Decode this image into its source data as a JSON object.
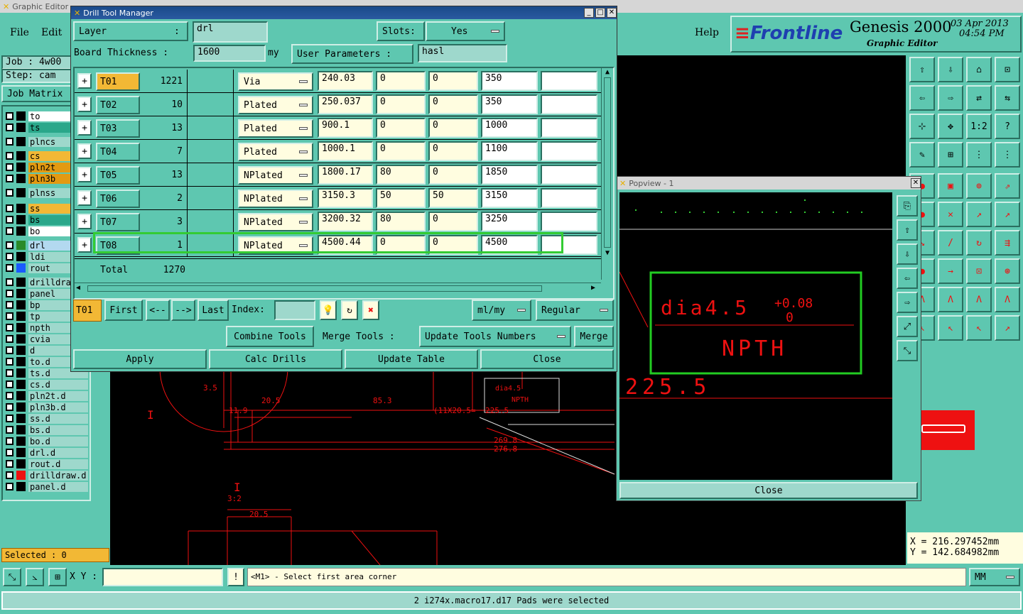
{
  "main_window": {
    "title": "Graphic Editor",
    "menu": [
      "File",
      "Edit"
    ],
    "help": "Help"
  },
  "brand": {
    "logo": "Frontline",
    "product": "Genesis 2000",
    "subtitle": "Graphic Editor",
    "date": "03 Apr 2013",
    "time": "04:54 PM"
  },
  "job": {
    "job_label": "Job : 4w00",
    "step_label": "Step: cam",
    "matrix_button": "Job Matrix"
  },
  "layers": [
    {
      "name": "to",
      "color": "#ffffff"
    },
    {
      "name": "ts",
      "color": "#2aa78a"
    },
    {
      "name": "plncs",
      "color": "#9ed8cc"
    },
    {
      "name": "cs",
      "color": "#f2b835"
    },
    {
      "name": "pln2t",
      "color": "#e39a12"
    },
    {
      "name": "pln3b",
      "color": "#e39a12"
    },
    {
      "name": "plnss",
      "color": "#9ed8cc"
    },
    {
      "name": "ss",
      "color": "#f2b835"
    },
    {
      "name": "bs",
      "color": "#2aa78a"
    },
    {
      "name": "bo",
      "color": "#ffffff"
    },
    {
      "name": "drl",
      "color": "#b3d9f0"
    },
    {
      "name": "ldi",
      "color": "#9ed8cc"
    },
    {
      "name": "rout",
      "color": "#9ed8cc"
    },
    {
      "name": "drilldraw",
      "color": "#9ed8cc"
    },
    {
      "name": "panel",
      "color": "#9ed8cc"
    },
    {
      "name": "bp",
      "color": "#9ed8cc"
    },
    {
      "name": "tp",
      "color": "#9ed8cc"
    },
    {
      "name": "npth",
      "color": "#9ed8cc"
    },
    {
      "name": "cvia",
      "color": "#9ed8cc"
    },
    {
      "name": "d",
      "color": "#9ed8cc"
    },
    {
      "name": "to.d",
      "color": "#9ed8cc"
    },
    {
      "name": "ts.d",
      "color": "#9ed8cc"
    },
    {
      "name": "cs.d",
      "color": "#9ed8cc"
    },
    {
      "name": "pln2t.d",
      "color": "#9ed8cc"
    },
    {
      "name": "pln3b.d",
      "color": "#9ed8cc"
    },
    {
      "name": "ss.d",
      "color": "#9ed8cc"
    },
    {
      "name": "bs.d",
      "color": "#9ed8cc"
    },
    {
      "name": "bo.d",
      "color": "#9ed8cc"
    },
    {
      "name": "drl.d",
      "color": "#9ed8cc"
    },
    {
      "name": "rout.d",
      "color": "#9ed8cc"
    },
    {
      "name": "drilldraw.d",
      "color": "#9ed8cc"
    },
    {
      "name": "panel.d",
      "color": "#9ed8cc"
    }
  ],
  "selected": "Selected : 0",
  "bottom": {
    "xy_label": "X Y :",
    "prompt": "<M1> - Select first area corner",
    "units": "MM",
    "status": "2 i274x.macro17.d17 Pads were selected"
  },
  "coords": {
    "x": "X = 216.297452mm",
    "y": "Y = 142.684982mm"
  },
  "dtm": {
    "title": "Drill Tool Manager",
    "layer_label": "Layer",
    "layer_colon": ":",
    "layer_value": "drl",
    "slots_label": "Slots:",
    "slots_value": "Yes",
    "thickness_label": "Board Thickness :",
    "thickness_value": "1600",
    "thickness_unit": "my",
    "userparams_label": "User Parameters :",
    "userparams_value": "hasl",
    "rows": [
      {
        "tool": "T01",
        "count": "1221",
        "type": "Via",
        "size": "240.03",
        "p1": "0",
        "p2": "0",
        "finish": "350",
        "extra": ""
      },
      {
        "tool": "T02",
        "count": "10",
        "type": "Plated",
        "size": "250.037",
        "p1": "0",
        "p2": "0",
        "finish": "350",
        "extra": ""
      },
      {
        "tool": "T03",
        "count": "13",
        "type": "Plated",
        "size": "900.1",
        "p1": "0",
        "p2": "0",
        "finish": "1000",
        "extra": ""
      },
      {
        "tool": "T04",
        "count": "7",
        "type": "Plated",
        "size": "1000.1",
        "p1": "0",
        "p2": "0",
        "finish": "1100",
        "extra": ""
      },
      {
        "tool": "T05",
        "count": "13",
        "type": "NPlated",
        "size": "1800.17",
        "p1": "80",
        "p2": "0",
        "finish": "1850",
        "extra": ""
      },
      {
        "tool": "T06",
        "count": "2",
        "type": "NPlated",
        "size": "3150.3",
        "p1": "50",
        "p2": "50",
        "finish": "3150",
        "extra": ""
      },
      {
        "tool": "T07",
        "count": "3",
        "type": "NPlated",
        "size": "3200.32",
        "p1": "80",
        "p2": "0",
        "finish": "3250",
        "extra": ""
      },
      {
        "tool": "T08",
        "count": "1",
        "type": "NPlated",
        "size": "4500.44",
        "p1": "0",
        "p2": "0",
        "finish": "4500",
        "extra": ""
      }
    ],
    "total_label": "Total",
    "total_value": "1270",
    "current_tool": "T01",
    "nav": {
      "first": "First",
      "prev": "<--",
      "next": "-->",
      "last": "Last",
      "index_label": "Index:"
    },
    "units_option": "ml/my",
    "mode_option": "Regular",
    "combine": "Combine Tools",
    "merge_label": "Merge Tools :",
    "update_numbers": "Update Tools Numbers",
    "merge": "Merge",
    "apply": "Apply",
    "calc": "Calc Drills",
    "update_table": "Update Table",
    "close": "Close"
  },
  "popview": {
    "title": "Popview - 1",
    "text1": "dia4.5",
    "tol_plus": "+0.08",
    "tol_minus": "0",
    "text2": "NPTH",
    "dim": "225.5",
    "close": "Close"
  },
  "drawing": {
    "labels": [
      "3.5",
      "20.5",
      "85.3",
      "11.9",
      "(11X20.5=",
      "225.5",
      "269.8",
      "276.8",
      "3:2",
      "20.5",
      "dia4.5",
      "NPTH"
    ]
  }
}
